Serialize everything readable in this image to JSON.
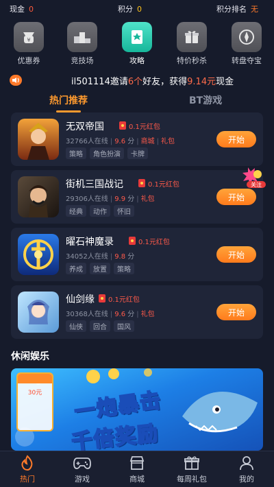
{
  "stats": {
    "cash_label": "现金",
    "cash_value": "0",
    "points_label": "积分",
    "points_value": "0",
    "rank_label": "积分排名",
    "rank_value": "无"
  },
  "shortcuts": [
    {
      "label": "优惠券",
      "icon": "coupon-icon"
    },
    {
      "label": "竞技场",
      "icon": "podium-icon"
    },
    {
      "label": "攻略",
      "icon": "guide-book-icon"
    },
    {
      "label": "特价秒杀",
      "icon": "gift-box-icon"
    },
    {
      "label": "转盘夺宝",
      "icon": "compass-icon"
    }
  ],
  "ticker": {
    "user": "il501114邀请",
    "count": "6个",
    "mid": "好友，获得",
    "amount": "9.14元",
    "tail": "现金"
  },
  "tabs": [
    {
      "label": "热门推荐",
      "active": true
    },
    {
      "label": "BT游戏",
      "active": false
    }
  ],
  "games": [
    {
      "name": "无双帝国",
      "redpack": "0.1元红包",
      "online": "32766人在线",
      "score": "9.6",
      "score_unit": "分",
      "extra1": "商城",
      "extra2": "礼包",
      "tags": [
        "策略",
        "角色扮演",
        "卡牌"
      ],
      "button": "开始"
    },
    {
      "name": "街机三国战记",
      "redpack": "0.1元红包",
      "online": "29306人在线",
      "score": "9.9",
      "score_unit": "分",
      "extra1": "礼包",
      "tags": [
        "经典",
        "动作",
        "怀旧"
      ],
      "button": "开始"
    },
    {
      "name": "曜石神魔录",
      "redpack": "0.1元红包",
      "online": "34052人在线",
      "score": "9.8",
      "score_unit": "分",
      "tags": [
        "养成",
        "放置",
        "策略"
      ],
      "button": "开始"
    },
    {
      "name": "仙剑缘",
      "redpack": "0.1元红包",
      "online": "30368人在线",
      "score": "9.6",
      "score_unit": "分",
      "extra1": "礼包",
      "tags": [
        "仙侠",
        "回合",
        "国风"
      ],
      "button": "开始"
    }
  ],
  "float_badge": {
    "label": "关注"
  },
  "leisure": {
    "title": "休闲娱乐",
    "banner_line1": "一炮暴击",
    "banner_line2": "千倍奖励",
    "coupon_amount": "30元"
  },
  "nav": [
    {
      "label": "热门",
      "icon": "flame-icon",
      "active": true
    },
    {
      "label": "游戏",
      "icon": "gamepad-icon",
      "active": false
    },
    {
      "label": "商城",
      "icon": "store-icon",
      "active": false
    },
    {
      "label": "每周礼包",
      "icon": "gift-icon",
      "active": false
    },
    {
      "label": "我的",
      "icon": "user-icon",
      "active": false
    }
  ],
  "colors": {
    "background": "#161b2b",
    "card": "#1f2538",
    "accent": "#ff9a2e",
    "highlight": "#ff5a4a"
  }
}
